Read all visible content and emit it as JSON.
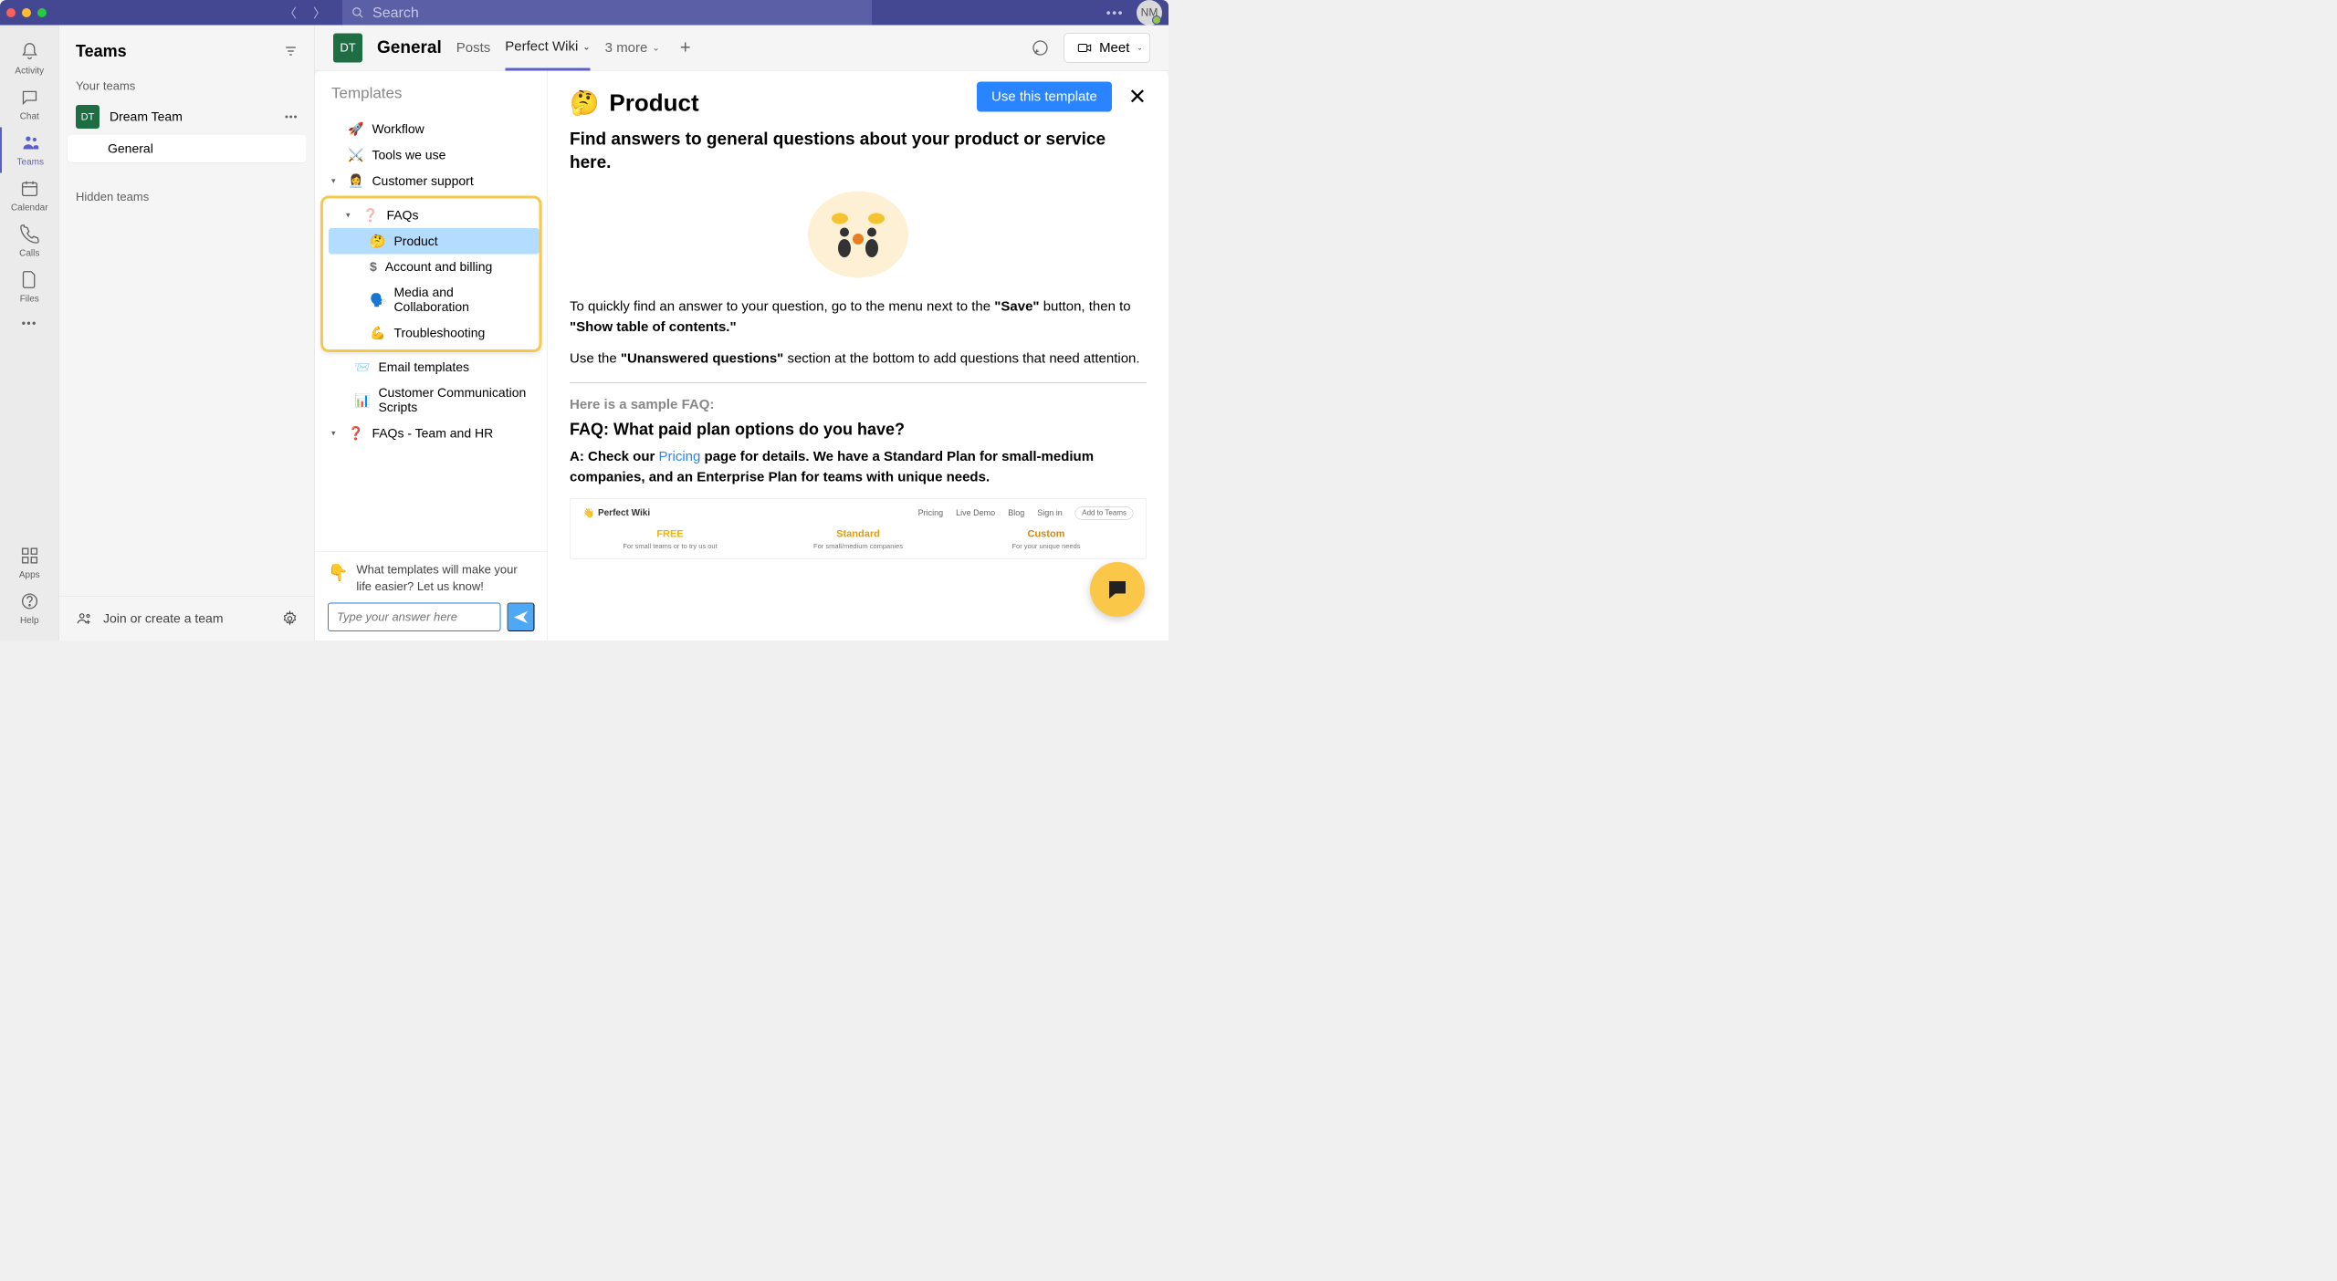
{
  "titlebar": {
    "search_placeholder": "Search",
    "avatar_initials": "NM"
  },
  "leftrail": {
    "activity": "Activity",
    "chat": "Chat",
    "teams": "Teams",
    "calendar": "Calendar",
    "calls": "Calls",
    "files": "Files",
    "apps": "Apps",
    "help": "Help"
  },
  "teams_panel": {
    "header": "Teams",
    "your_teams": "Your teams",
    "team_badge": "DT",
    "team_name": "Dream Team",
    "channel_general": "General",
    "hidden_teams": "Hidden teams",
    "join_create": "Join or create a team"
  },
  "content_header": {
    "badge": "DT",
    "title": "General",
    "tab_posts": "Posts",
    "tab_perfect": "Perfect Wiki",
    "tab_more": "3 more",
    "meet": "Meet"
  },
  "templates": {
    "heading": "Templates",
    "items": {
      "workflow": "Workflow",
      "tools": "Tools we use",
      "customer_support": "Customer support",
      "faqs": "FAQs",
      "product": "Product",
      "account": "Account and billing",
      "media": "Media and Collaboration",
      "trouble": "Troubleshooting",
      "email": "Email templates",
      "comm_scripts": "Customer Communication Scripts",
      "faqs_team": "FAQs - Team and HR"
    },
    "footer_prompt": "What templates will make your life easier? Let us know!",
    "input_placeholder": "Type your answer here"
  },
  "preview": {
    "use_btn": "Use this template",
    "title": "Product",
    "subtitle": "Find answers to general questions about your product or service here.",
    "para1_a": "To quickly find an answer to your question, go to the menu next to the ",
    "para1_b": "\"Save\"",
    "para1_c": " button, then to ",
    "para1_d": "\"Show table of contents.\"",
    "para2_a": "Use the ",
    "para2_b": "\"Unanswered questions\"",
    "para2_c": " section at the bottom to add questions that need attention.",
    "sample_label": "Here is a sample FAQ:",
    "faq_q": "FAQ: What paid plan options do you have?",
    "faq_a_pre": "A: Check our ",
    "faq_a_link": "Pricing",
    "faq_a_post": " page for details. We have a Standard Plan for small-medium companies, and an Enterprise Plan for teams with unique needs.",
    "pricing_brand": "Perfect Wiki",
    "pricing_nav": [
      "Pricing",
      "Live Demo",
      "Blog",
      "Sign in"
    ],
    "pricing_add": "Add to Teams",
    "tiers": [
      {
        "name": "FREE",
        "desc": "For small teams or to try us out"
      },
      {
        "name": "Standard",
        "desc": "For small/medium companies"
      },
      {
        "name": "Custom",
        "desc": "For your unique needs"
      }
    ]
  },
  "icons": {
    "workflow": "🚀",
    "tools": "⚔️",
    "support": "👩‍💼",
    "faqs": "❓",
    "product": "🤔",
    "account": "$",
    "media": "🗣️",
    "trouble": "💪",
    "email": "📨",
    "scripts": "📊",
    "faqs_team": "❓",
    "point_down": "👇"
  }
}
